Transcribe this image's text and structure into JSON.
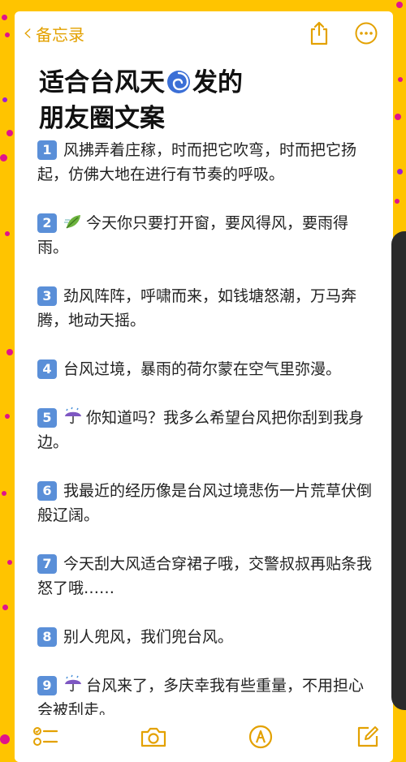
{
  "nav": {
    "back_label": "备忘录"
  },
  "note": {
    "title_before": "适合台风天",
    "title_emoji": "cyclone-icon",
    "title_after": "发的",
    "title_line2": "朋友圈文案",
    "items": [
      {
        "num": "1",
        "icon": "",
        "text": "风拂弄着庄稼，时而把它吹弯，时而把它扬起，仿佛大地在进行有节奏的呼吸。"
      },
      {
        "num": "2",
        "icon": "leaf-wind-icon",
        "text": "今天你只要打开窗，要风得风，要雨得雨。"
      },
      {
        "num": "3",
        "icon": "",
        "text": "劲风阵阵，呼啸而来，如钱塘怒潮，万马奔腾，地动天摇。"
      },
      {
        "num": "4",
        "icon": "",
        "text": "台风过境，暴雨的荷尔蒙在空气里弥漫。"
      },
      {
        "num": "5",
        "icon": "umbrella-rain-icon",
        "text": "你知道吗？我多么希望台风把你刮到我身边。"
      },
      {
        "num": "6",
        "icon": "",
        "text": "我最近的经历像是台风过境悲伤一片荒草伏倒般辽阔。"
      },
      {
        "num": "7",
        "icon": "",
        "text": "今天刮大风适合穿裙子哦，交警叔叔再贴条我怒了哦……"
      },
      {
        "num": "8",
        "icon": "",
        "text": "别人兜风，我们兜台风。"
      },
      {
        "num": "9",
        "icon": "umbrella-rain-icon",
        "text": "台风来了，多庆幸我有些重量，不用担心会被刮走。"
      }
    ]
  },
  "colors": {
    "background": "#FFC400",
    "accent": "#E3A100",
    "number_badge": "#5A8FD8",
    "confetti": "#E0138C"
  },
  "toolbar": {
    "icons": [
      "checklist-icon",
      "camera-icon",
      "markup-icon",
      "compose-icon"
    ]
  }
}
